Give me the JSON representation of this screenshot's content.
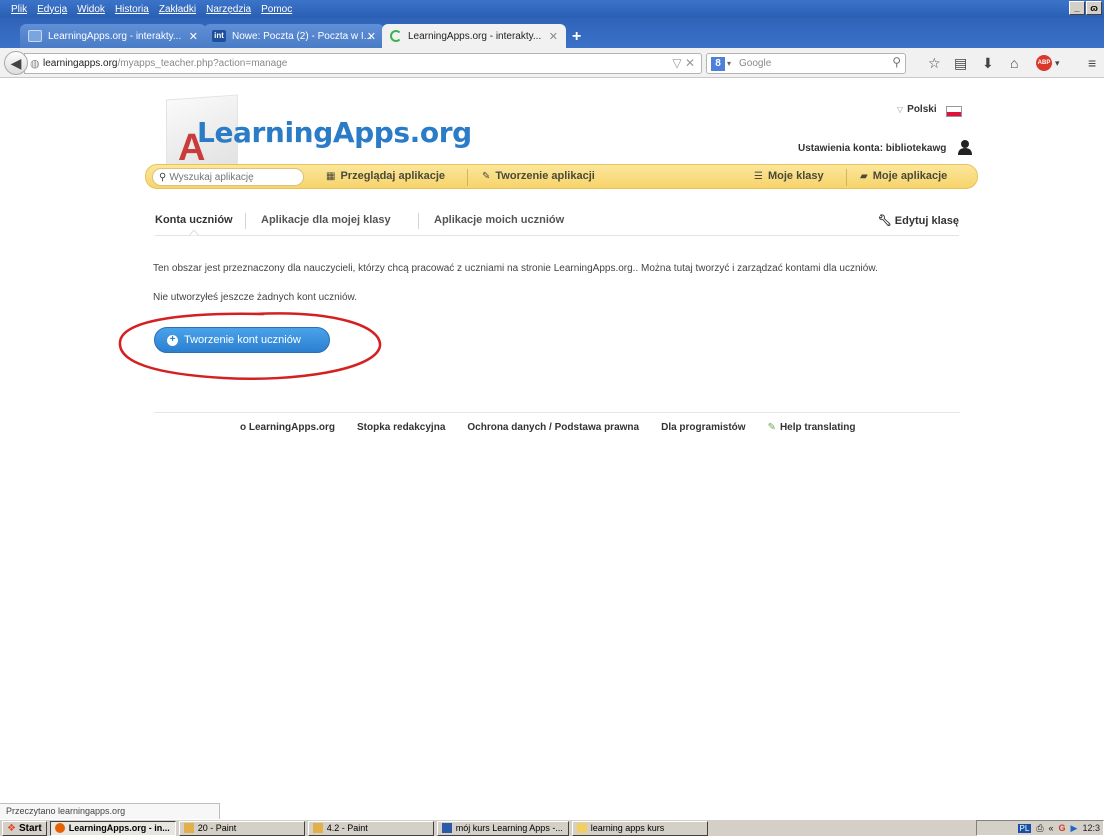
{
  "menubar": [
    "Plik",
    "Edycja",
    "Widok",
    "Historia",
    "Zakładki",
    "Narzędzia",
    "Pomoc"
  ],
  "window_buttons": [
    "_",
    "ɷ"
  ],
  "tabs": [
    {
      "title": "LearningApps.org - interakty...",
      "close": "✕"
    },
    {
      "title": "Nowe: Poczta (2) - Poczta w I...",
      "close": "✕"
    },
    {
      "title": "LearningApps.org - interakty...",
      "close": "✕"
    }
  ],
  "newtab": "+",
  "url": {
    "host": "learningapps.org",
    "path": "/myapps_teacher.php?action=manage"
  },
  "url_controls": "▽ ✕",
  "search": {
    "engine": "8",
    "placeholder": "Google"
  },
  "site": {
    "language": "Polski",
    "logo_text": "LearningApps.org",
    "logo_letter": "A",
    "account_label": "Ustawienia konta: bibliotekawg",
    "search_placeholder": "Wyszukaj aplikację",
    "nav": {
      "browse": "Przeglądaj aplikacje",
      "create": "Tworzenie aplikacji",
      "classes": "Moje klasy",
      "myapps": "Moje aplikacje"
    },
    "subtabs": {
      "accounts": "Konta uczniów",
      "class_apps": "Aplikacje dla mojej klasy",
      "student_apps": "Aplikacje moich uczniów",
      "edit_class": "Edytuj klasę"
    },
    "description": "Ten obszar jest przeznaczony dla nauczycieli, którzy chcą pracować z uczniami na stronie LearningApps.org.. Można tutaj tworzyć i zarządzać kontami dla uczniów.",
    "no_accounts": "Nie utworzyłeś jeszcze żadnych kont uczniów.",
    "create_button": "Tworzenie kont uczniów",
    "footer": {
      "about": "o LearningApps.org",
      "imprint": "Stopka redakcyjna",
      "privacy": "Ochrona danych / Podstawa prawna",
      "developers": "Dla programistów",
      "translate": "Help translating"
    }
  },
  "statusbar": "Przeczytano learningapps.org",
  "taskbar": {
    "start": "Start",
    "tasks": [
      "LearningApps.org - in...",
      "20 - Paint",
      "4.2 - Paint",
      "mój kurs Learning Apps -...",
      "learning apps kurs"
    ],
    "tray_lang": "PL",
    "clock": "12:3"
  },
  "colors": {
    "accent": "#2a7cc6",
    "nav_yellow": "#f7d46b",
    "button_blue": "#2b7fd0",
    "annotation_red": "#d42020"
  }
}
